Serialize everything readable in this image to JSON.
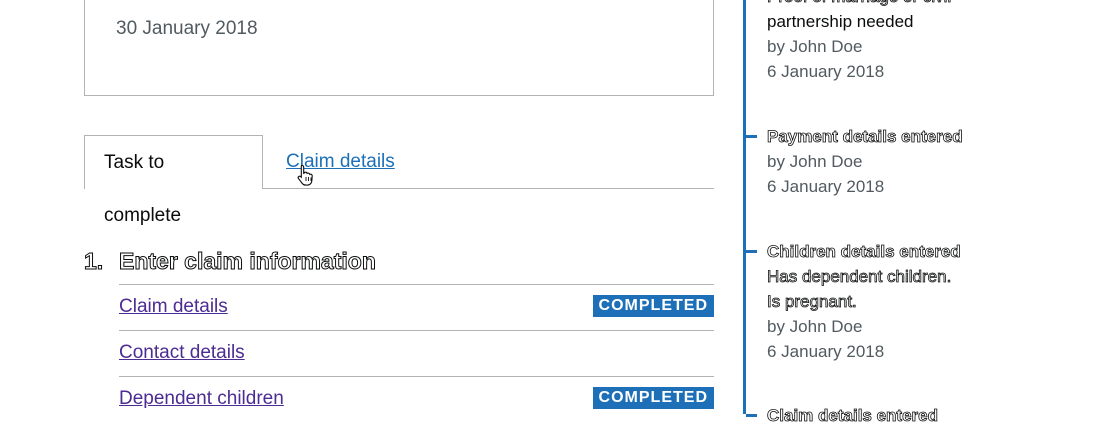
{
  "summary_box": {
    "date": "30 January 2018"
  },
  "tabs": [
    {
      "label": "Task to complete",
      "active": true
    },
    {
      "label": "Claim details",
      "active": false
    }
  ],
  "task_section": {
    "number": "1.",
    "title": "Enter claim information",
    "tasks": [
      {
        "label": "Claim details",
        "status": "COMPLETED"
      },
      {
        "label": "Contact details",
        "status": ""
      },
      {
        "label": "Dependent children",
        "status": "COMPLETED"
      }
    ]
  },
  "colors": {
    "accent": "#1d70b8",
    "link": "#4c2c92",
    "badge": "#1d70b8"
  },
  "timeline": [
    {
      "title_lines": [
        "Proof of marriage or civil",
        "partnership needed"
      ],
      "author": "by John Doe",
      "date": "6 January 2018",
      "notes": []
    },
    {
      "title_lines": [
        "Payment details entered"
      ],
      "author": "by John Doe",
      "date": "6 January 2018",
      "notes": []
    },
    {
      "title_lines": [
        "Children details entered"
      ],
      "author": "by John Doe",
      "date": "6 January 2018",
      "notes": [
        "Has dependent children.",
        "Is pregnant."
      ]
    },
    {
      "title_lines": [
        "Claim details entered"
      ],
      "author": "",
      "date": "",
      "notes": []
    }
  ]
}
